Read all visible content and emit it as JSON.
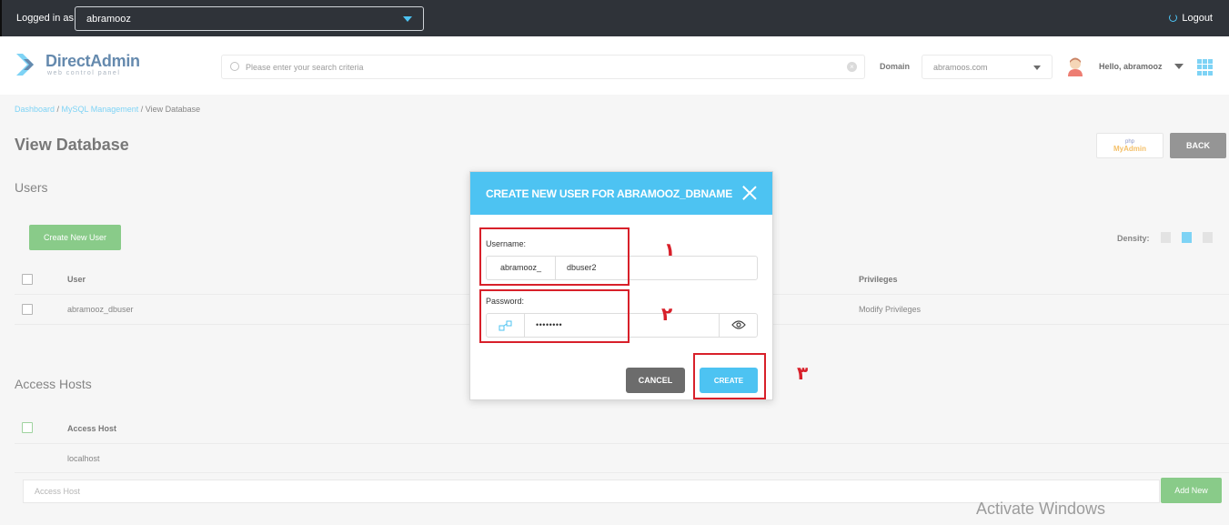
{
  "topbar": {
    "logged_in_label": "Logged in as",
    "user_value": "abramooz",
    "logout_label": "Logout"
  },
  "header": {
    "logo_name": "DirectAdmin",
    "logo_tagline": "web control panel",
    "search_placeholder": "Please enter your search criteria",
    "domain_label": "Domain",
    "domain_value": "abramoos.com",
    "greeting": "Hello, abramooz"
  },
  "breadcrumb": {
    "dashboard": "Dashboard",
    "mysql": "MySQL Management",
    "current": "View Database",
    "sep": " / "
  },
  "page": {
    "title": "View Database",
    "phpmyadmin_top": "php",
    "phpmyadmin_bottom": "MyAdmin",
    "back_label": "BACK"
  },
  "users": {
    "section_title": "Users",
    "create_button": "Create New User",
    "density_label": "Density:",
    "columns": [
      "User",
      "Privileges"
    ],
    "rows": [
      {
        "user": "abramooz_dbuser",
        "privileges": "Modify Privileges"
      }
    ]
  },
  "access_hosts": {
    "section_title": "Access Hosts",
    "column": "Access Host",
    "rows": [
      "localhost"
    ],
    "input_placeholder": "Access Host",
    "add_button": "Add New"
  },
  "modal": {
    "title": "CREATE NEW USER FOR ABRAMOOZ_DBNAME",
    "username_label": "Username:",
    "username_prefix": "abramooz_",
    "username_value": "dbuser2",
    "password_label": "Password:",
    "password_value": "••••••••",
    "cancel_label": "CANCEL",
    "create_label": "CREATE"
  },
  "annotations": {
    "step1": "١",
    "step2": "٢",
    "step3": "٣"
  },
  "watermark": "Activate Windows",
  "colors": {
    "accent": "#4dc3f2",
    "green": "#5cb85c",
    "annotation_red": "#d8202a",
    "topbar": "#2f3339"
  }
}
